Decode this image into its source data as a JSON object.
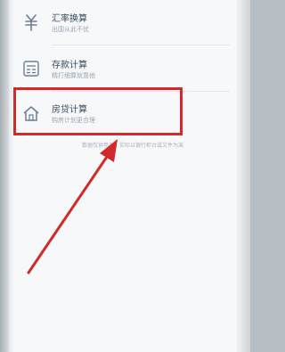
{
  "menu": {
    "items": [
      {
        "title": "汇率换算",
        "subtitle": "出国从此不忧",
        "icon": "currency-icon"
      },
      {
        "title": "存款计算",
        "subtitle": "精打细算就靠他",
        "icon": "calculator-icon"
      },
      {
        "title": "房贷计算",
        "subtitle": "购房计划更合理",
        "icon": "house-icon"
      }
    ]
  },
  "footer": {
    "note": "数据仅供参考，实际以银行柜台或文件为准"
  },
  "colors": {
    "accent": "#6b7f93",
    "highlight": "#d22a2a",
    "background": "#f6f8fa"
  }
}
